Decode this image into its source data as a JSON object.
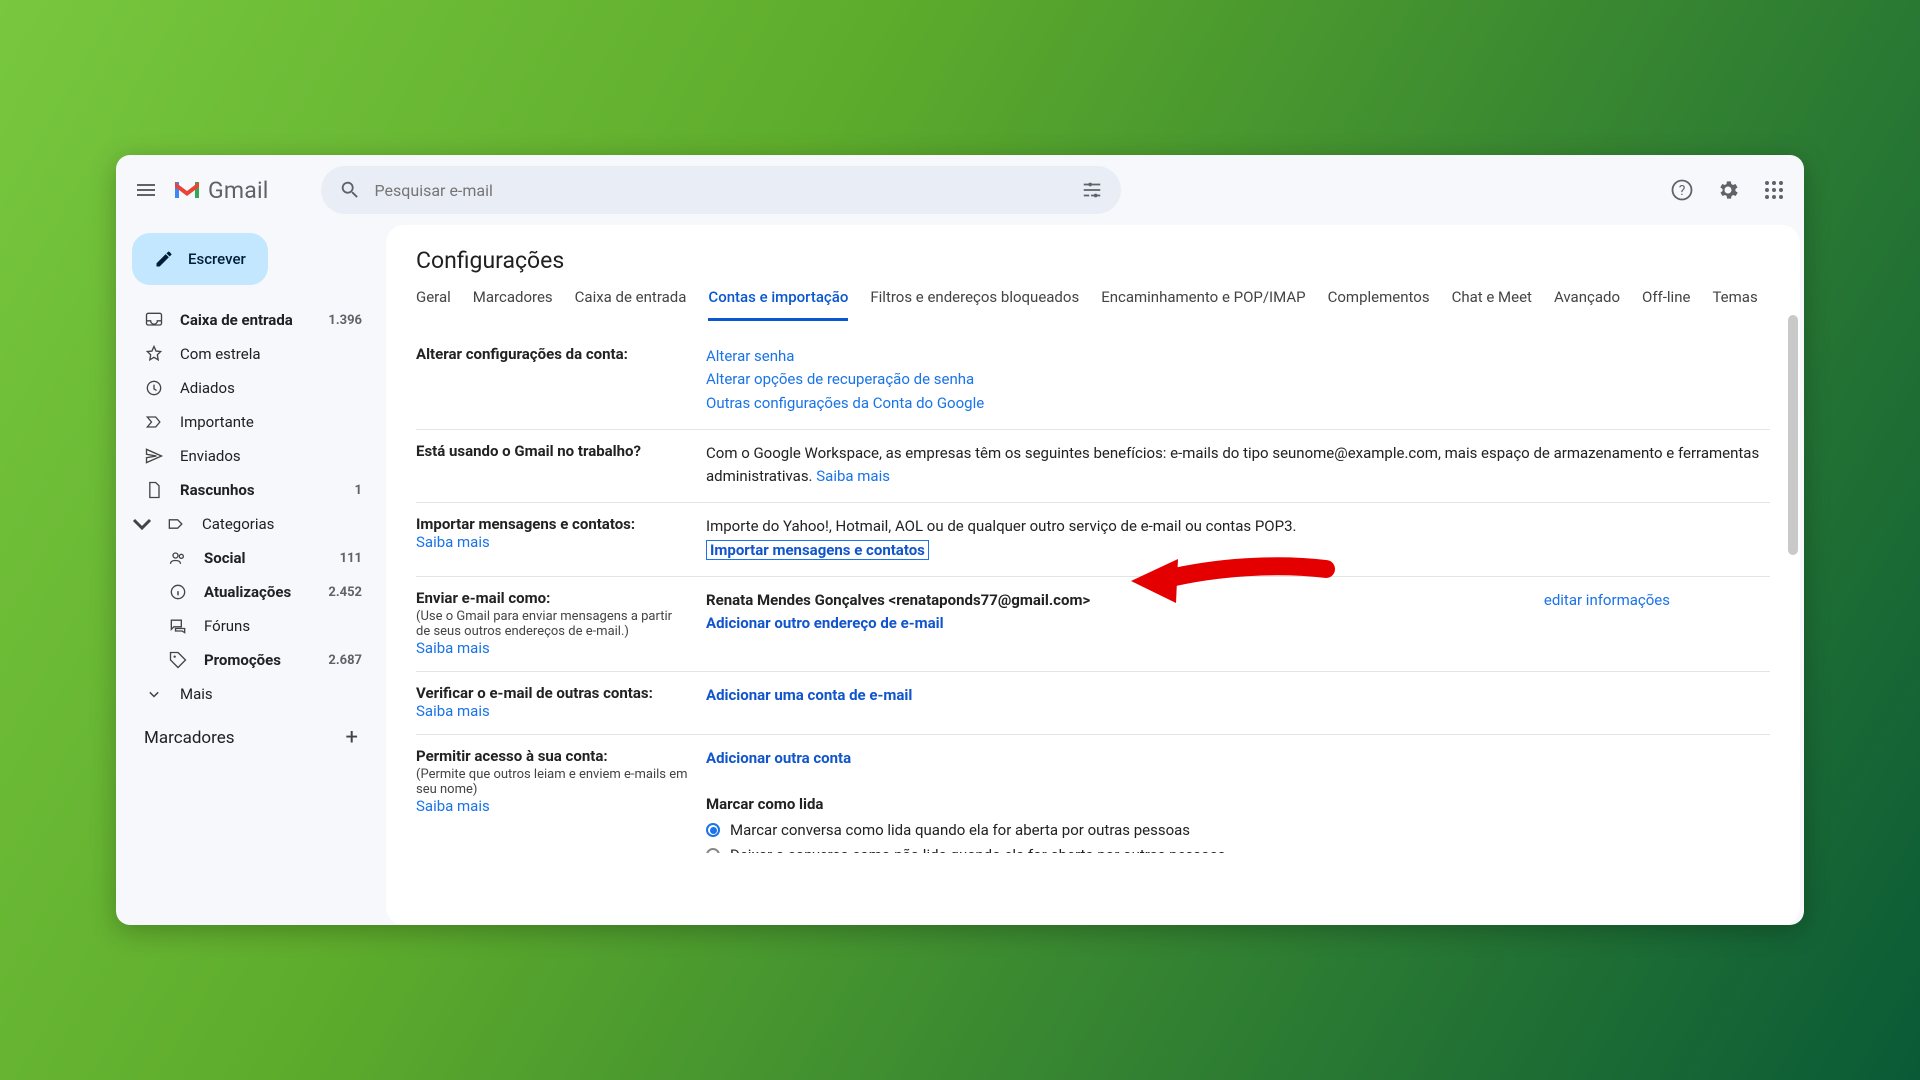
{
  "app": {
    "name": "Gmail",
    "search_placeholder": "Pesquisar e-mail"
  },
  "compose": {
    "label": "Escrever"
  },
  "sidebar": {
    "items": [
      {
        "icon": "inbox",
        "label": "Caixa de entrada",
        "count": "1.396",
        "bold": true
      },
      {
        "icon": "star",
        "label": "Com estrela"
      },
      {
        "icon": "clock",
        "label": "Adiados"
      },
      {
        "icon": "important",
        "label": "Importante"
      },
      {
        "icon": "send",
        "label": "Enviados"
      },
      {
        "icon": "draft",
        "label": "Rascunhos",
        "count": "1",
        "bold": true
      },
      {
        "icon": "category",
        "label": "Categorias",
        "expandable": true
      }
    ],
    "sub_items": [
      {
        "icon": "people",
        "label": "Social",
        "count": "111",
        "bold": true
      },
      {
        "icon": "info",
        "label": "Atualizações",
        "count": "2.452",
        "bold": true
      },
      {
        "icon": "forum",
        "label": "Fóruns"
      },
      {
        "icon": "tag",
        "label": "Promoções",
        "count": "2.687",
        "bold": true
      },
      {
        "icon": "more",
        "label": "Mais"
      }
    ],
    "labels_title": "Marcadores"
  },
  "page_title": "Configurações",
  "tabs": [
    "Geral",
    "Marcadores",
    "Caixa de entrada",
    "Contas e importação",
    "Filtros e endereços bloqueados",
    "Encaminhamento e POP/IMAP",
    "Complementos",
    "Chat e Meet",
    "Avançado",
    "Off-line",
    "Temas"
  ],
  "active_tab": "Contas e importação",
  "sections": {
    "account": {
      "title": "Alterar configurações da conta:",
      "links": [
        "Alterar senha",
        "Alterar opções de recuperação de senha",
        "Outras configurações da Conta do Google"
      ]
    },
    "work": {
      "title": "Está usando o Gmail no trabalho?",
      "text": "Com o Google Workspace, as empresas têm os seguintes benefícios: e-mails do tipo seunome@example.com, mais espaço de armazenamento e ferramentas administrativas. ",
      "learn": "Saiba mais"
    },
    "import": {
      "title": "Importar mensagens e contatos:",
      "learn": "Saiba mais",
      "text": "Importe do Yahoo!, Hotmail, AOL ou de qualquer outro serviço de e-mail ou contas POP3.",
      "action": "Importar mensagens e contatos"
    },
    "sendas": {
      "title": "Enviar e-mail como:",
      "sub": "(Use o Gmail para enviar mensagens a partir de seus outros endereços de e-mail.)",
      "learn": "Saiba mais",
      "identity": "Renata Mendes Gonçalves <renataponds77@gmail.com>",
      "add": "Adicionar outro endereço de e-mail",
      "edit": "editar informações"
    },
    "check": {
      "title": "Verificar o e-mail de outras contas:",
      "learn": "Saiba mais",
      "add": "Adicionar uma conta de e-mail"
    },
    "grant": {
      "title": "Permitir acesso à sua conta:",
      "sub": "(Permite que outros leiam e enviem e-mails em seu nome)",
      "learn": "Saiba mais",
      "add": "Adicionar outra conta",
      "mark_title": "Marcar como lida",
      "opt1": "Marcar conversa como lida quando ela for aberta por outras pessoas",
      "opt2": "Deixar a conversa como não lida quando ela for aberta por outras pessoas"
    }
  }
}
